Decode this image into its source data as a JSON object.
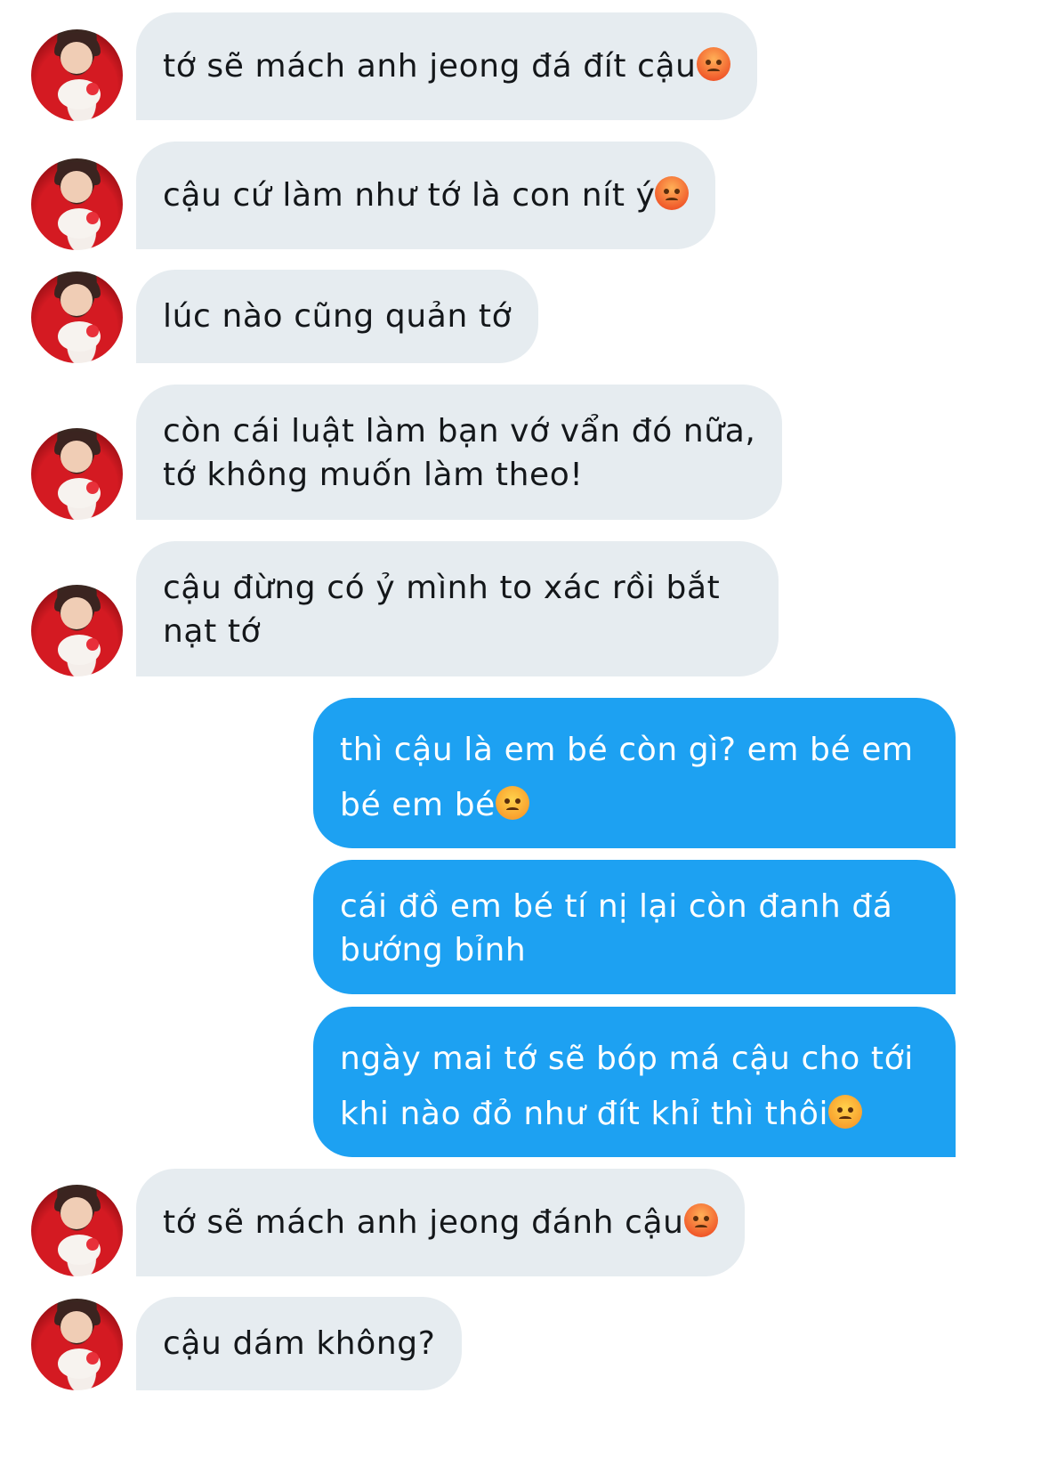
{
  "messages": [
    {
      "side": "in",
      "text": "tớ sẽ mách anh jeong đá đít cậu",
      "emoji": "pouting-face-icon"
    },
    {
      "side": "in",
      "text": "cậu cứ làm như tớ là con nít ý",
      "emoji": "pouting-face-icon"
    },
    {
      "side": "in",
      "text": "lúc nào cũng quản tớ",
      "emoji": ""
    },
    {
      "side": "in",
      "text": "còn cái luật làm bạn vớ vẩn đó nữa,\ntớ không muốn làm theo!",
      "emoji": ""
    },
    {
      "side": "in",
      "text": "cậu đừng có ỷ mình to xác rồi bắt\nnạt tớ",
      "emoji": ""
    },
    {
      "side": "out",
      "text": "thì cậu là em bé còn gì? em bé em\nbé em bé",
      "emoji": "angry-face-icon"
    },
    {
      "side": "out",
      "text": "cái đồ em bé tí nị lại còn đanh đá\nbướng bỉnh",
      "emoji": ""
    },
    {
      "side": "out",
      "text": "ngày mai tớ sẽ bóp má cậu cho tới\nkhi nào đỏ như đít khỉ thì thôi",
      "emoji": "angry-face-icon"
    },
    {
      "side": "in",
      "text": "tớ sẽ mách anh jeong đánh cậu",
      "emoji": "pouting-face-icon"
    },
    {
      "side": "in",
      "text": "cậu dám không?",
      "emoji": ""
    }
  ],
  "colors": {
    "incoming_bubble": "#e6ecf0",
    "outgoing_bubble": "#1da1f2",
    "incoming_text": "#14171a",
    "outgoing_text": "#ffffff"
  }
}
